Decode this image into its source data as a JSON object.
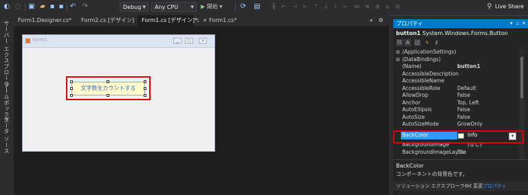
{
  "toolbar": {
    "config": "Debug",
    "platform": "Any CPU",
    "start_label": "開始",
    "live_share": "Live Share"
  },
  "left_tabs": [
    "サーバー エクスプローラー",
    "ツールボックス",
    "データ ソース"
  ],
  "doc_tabs": [
    "Form1.Designer.cs*",
    "Form2.cs [デザイン]",
    "Form1.cs [デザイン]*",
    "Form1.cs*"
  ],
  "form": {
    "title": "Form1",
    "button_text": "文字数をカウントする"
  },
  "properties": {
    "header": "プロパティ",
    "object_name": "button1",
    "object_type": "System.Windows.Forms.Button",
    "rows": [
      {
        "name": "(ApplicationSettings)",
        "value": "",
        "expander": "⊞"
      },
      {
        "name": "(DataBindings)",
        "value": "",
        "expander": "⊞"
      },
      {
        "name": "(Name)",
        "value": "button1",
        "expander": ""
      },
      {
        "name": "AccessibleDescription",
        "value": "",
        "expander": ""
      },
      {
        "name": "AccessibleName",
        "value": "",
        "expander": ""
      },
      {
        "name": "AccessibleRole",
        "value": "Default",
        "expander": ""
      },
      {
        "name": "AllowDrop",
        "value": "False",
        "expander": ""
      },
      {
        "name": "Anchor",
        "value": "Top, Left",
        "expander": ""
      },
      {
        "name": "AutoEllipsis",
        "value": "False",
        "expander": ""
      },
      {
        "name": "AutoSize",
        "value": "False",
        "expander": ""
      },
      {
        "name": "AutoSizeMode",
        "value": "GrowOnly",
        "expander": ""
      },
      {
        "name": "BackColor",
        "value": "Info",
        "expander": ""
      },
      {
        "name": "BackgroundImage",
        "value": "(なし)",
        "expander": ""
      },
      {
        "name": "BackgroundImageLayou",
        "value": "Tile",
        "expander": ""
      }
    ],
    "desc_title": "BackColor",
    "desc_text": "コンポーネントの背景色です。",
    "swatch_color": "#ffffe1"
  },
  "bottom_tabs": [
    "ソリューション エクスプローラー",
    "Git 変更",
    "プロパティ"
  ]
}
